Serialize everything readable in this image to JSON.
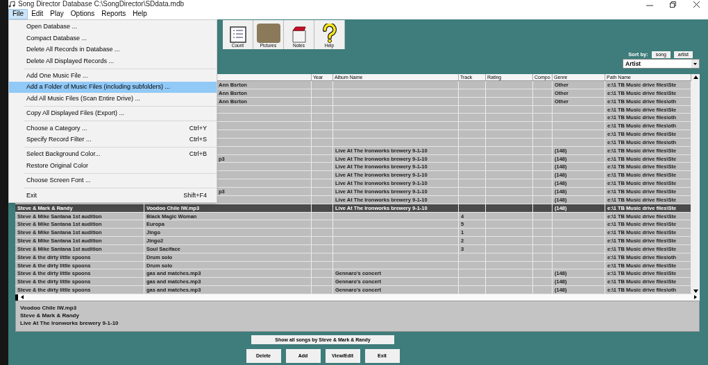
{
  "window": {
    "title": "Song Director Database  C:\\SongDirector\\SDdata.mdb"
  },
  "menubar": [
    {
      "label": "File",
      "selected": true
    },
    {
      "label": "Edit",
      "selected": false
    },
    {
      "label": "Play",
      "selected": false
    },
    {
      "label": "Options",
      "selected": false
    },
    {
      "label": "Reports",
      "selected": false
    },
    {
      "label": "Help",
      "selected": false
    }
  ],
  "file_menu": [
    {
      "kind": "item",
      "label": "Open Database ...",
      "selected": false
    },
    {
      "kind": "item",
      "label": "Compact Database ...",
      "selected": false
    },
    {
      "kind": "item",
      "label": "Delete All Records in Database ...",
      "selected": false
    },
    {
      "kind": "item",
      "label": "Delete All Displayed Records ...",
      "selected": false
    },
    {
      "kind": "separator"
    },
    {
      "kind": "item",
      "label": "Add One Music File ...",
      "selected": false
    },
    {
      "kind": "item",
      "label": "Add a Folder of Music Files (including subfolders) ...",
      "selected": true
    },
    {
      "kind": "item",
      "label": "Add All Music Files (Scan Entire Drive) ...",
      "selected": false
    },
    {
      "kind": "separator"
    },
    {
      "kind": "item",
      "label": "Copy All Displayed Files (Export) ...",
      "selected": false
    },
    {
      "kind": "separator"
    },
    {
      "kind": "item",
      "label": "Choose a Category ...",
      "shortcut": "Ctrl+Y",
      "selected": false
    },
    {
      "kind": "item",
      "label": "Specify Record Filter ...",
      "shortcut": "Ctrl+S",
      "selected": false
    },
    {
      "kind": "separator"
    },
    {
      "kind": "item",
      "label": "Select Background Color...",
      "shortcut": "Ctrl+B",
      "selected": false
    },
    {
      "kind": "item",
      "label": "Restore Original Color",
      "selected": false
    },
    {
      "kind": "separator"
    },
    {
      "kind": "item",
      "label": "Choose Screen Font ...",
      "selected": false
    },
    {
      "kind": "separator"
    },
    {
      "kind": "item",
      "label": "Exit",
      "shortcut": "Shift+F4",
      "selected": false
    }
  ],
  "toolbar": [
    {
      "kind": "list",
      "label": "Count"
    },
    {
      "kind": "picture",
      "label": "Pictures"
    },
    {
      "kind": "notes",
      "label": "Notes"
    },
    {
      "kind": "help",
      "label": "Help"
    }
  ],
  "sort": {
    "label": "Sort by:",
    "buttons": [
      "song",
      "artist"
    ],
    "dropdown": "Artist"
  },
  "table": {
    "columns": [
      "",
      "",
      "Year",
      "Album Name",
      "Track",
      "Rating",
      "Compo",
      "Genre",
      "Path Name"
    ],
    "rows": [
      {
        "selected": false,
        "cells": [
          "",
          "Ann Bsrton",
          "",
          "",
          "",
          "",
          "",
          "Other",
          "e:\\1 TB Music drive files\\Ste"
        ]
      },
      {
        "selected": false,
        "cells": [
          "",
          "Ann Bsrton",
          "",
          "",
          "",
          "",
          "",
          "Other",
          "e:\\1 TB Music drive files\\Ste"
        ]
      },
      {
        "selected": false,
        "cells": [
          "",
          "Ann Bsrton",
          "",
          "",
          "",
          "",
          "",
          "Other",
          "e:\\1 TB Music drive files\\oth"
        ]
      },
      {
        "selected": false,
        "cells": [
          "",
          "",
          "",
          "",
          "",
          "",
          "",
          "",
          "e:\\1 TB Music drive files\\Ste"
        ]
      },
      {
        "selected": false,
        "cells": [
          "",
          "",
          "",
          "",
          "",
          "",
          "",
          "",
          "e:\\1 TB Music drive files\\oth"
        ]
      },
      {
        "selected": false,
        "cells": [
          "",
          "",
          "",
          "",
          "",
          "",
          "",
          "",
          "e:\\1 TB Music drive files\\oth"
        ]
      },
      {
        "selected": false,
        "cells": [
          "",
          "",
          "",
          "",
          "",
          "",
          "",
          "",
          "e:\\1 TB Music drive files\\Ste"
        ]
      },
      {
        "selected": false,
        "cells": [
          "",
          "",
          "",
          "",
          "",
          "",
          "",
          "",
          "e:\\1 TB Music drive files\\oth"
        ]
      },
      {
        "selected": false,
        "cells": [
          "",
          "",
          "",
          "Live At The Ironworks brewery 9-1-10",
          "",
          "",
          "",
          "(148)",
          "e:\\1 TB Music drive files\\Ste"
        ]
      },
      {
        "selected": false,
        "cells": [
          "",
          "p3",
          "",
          "Live At The Ironworks brewery 9-1-10",
          "",
          "",
          "",
          "(148)",
          "e:\\1 TB Music drive files\\Ste"
        ]
      },
      {
        "selected": false,
        "cells": [
          "",
          "",
          "",
          "Live At The Ironworks brewery 9-1-10",
          "",
          "",
          "",
          "(148)",
          "e:\\1 TB Music drive files\\Ste"
        ]
      },
      {
        "selected": false,
        "cells": [
          "",
          "",
          "",
          "Live At The Ironworks brewery 9-1-10",
          "",
          "",
          "",
          "(148)",
          "e:\\1 TB Music drive files\\Ste"
        ]
      },
      {
        "selected": false,
        "cells": [
          "",
          "",
          "",
          "Live At The Ironworks brewery 9-1-10",
          "",
          "",
          "",
          "(148)",
          "e:\\1 TB Music drive files\\Ste"
        ]
      },
      {
        "selected": false,
        "cells": [
          "",
          "p3",
          "",
          "Live At The Ironworks brewery 9-1-10",
          "",
          "",
          "",
          "(148)",
          "e:\\1 TB Music drive files\\Ste"
        ]
      },
      {
        "selected": false,
        "cells": [
          "",
          "",
          "",
          "Live At The Ironworks brewery 9-1-10",
          "",
          "",
          "",
          "(148)",
          "e:\\1 TB Music drive files\\Ste"
        ]
      },
      {
        "selected": true,
        "cells": [
          "Steve & Mark & Randy",
          "Voodoo Chile IW.mp3",
          "",
          "Live At The Ironworks brewery 9-1-10",
          "",
          "",
          "",
          "(148)",
          "e:\\1 TB Music drive files\\Ste"
        ]
      },
      {
        "selected": false,
        "cells": [
          "Steve & Mike Santana 1st audition",
          "Black Magic Woman",
          "",
          "",
          "4",
          "",
          "",
          "",
          "e:\\1 TB Music drive files\\Ste"
        ]
      },
      {
        "selected": false,
        "cells": [
          "Steve & Mike Santana 1st audition",
          "Europa",
          "",
          "",
          "5",
          "",
          "",
          "",
          "e:\\1 TB Music drive files\\Ste"
        ]
      },
      {
        "selected": false,
        "cells": [
          "Steve & Mike Santana 1st audition",
          "Jingo",
          "",
          "",
          "1",
          "",
          "",
          "",
          "e:\\1 TB Music drive files\\Ste"
        ]
      },
      {
        "selected": false,
        "cells": [
          "Steve & Mike Santana 1st audition",
          "Jingo2",
          "",
          "",
          "2",
          "",
          "",
          "",
          "e:\\1 TB Music drive files\\Ste"
        ]
      },
      {
        "selected": false,
        "cells": [
          "Steve & Mike Santana 1st audition",
          "Soul Saciface",
          "",
          "",
          "3",
          "",
          "",
          "",
          "e:\\1 TB Music drive files\\Ste"
        ]
      },
      {
        "selected": false,
        "cells": [
          "Steve & the dirty little spoons",
          "Drum solo",
          "",
          "",
          "",
          "",
          "",
          "",
          "e:\\1 TB Music drive files\\oth"
        ]
      },
      {
        "selected": false,
        "cells": [
          "Steve & the dirty little spoons",
          "Drum solo",
          "",
          "",
          "",
          "",
          "",
          "",
          "e:\\1 TB Music drive files\\Ste"
        ]
      },
      {
        "selected": false,
        "cells": [
          "Steve & the dirty little spoons",
          "gas and matches.mp3",
          "",
          "Gennaro's concert",
          "",
          "",
          "",
          "(148)",
          "e:\\1 TB Music drive files\\Ste"
        ]
      },
      {
        "selected": false,
        "cells": [
          "Steve & the dirty little spoons",
          "gas and matches.mp3",
          "",
          "Gennaro's concert",
          "",
          "",
          "",
          "(148)",
          "e:\\1 TB Music drive files\\Ste"
        ]
      },
      {
        "selected": false,
        "cells": [
          "Steve & the dirty little spoons",
          "gas and matches.mp3",
          "",
          "Gennaro's concert",
          "",
          "",
          "",
          "(148)",
          "e:\\1 TB Music drive files\\oth"
        ]
      }
    ]
  },
  "details": [
    "Voodoo Chile IW.mp3",
    "Steve & Mark & Randy",
    "Live At The Ironworks brewery 9-1-10"
  ],
  "show_all_button": "Show all songs by Steve & Mark & Randy",
  "buttons": [
    "Delete",
    "Add",
    "View/Edit",
    "Exit"
  ]
}
